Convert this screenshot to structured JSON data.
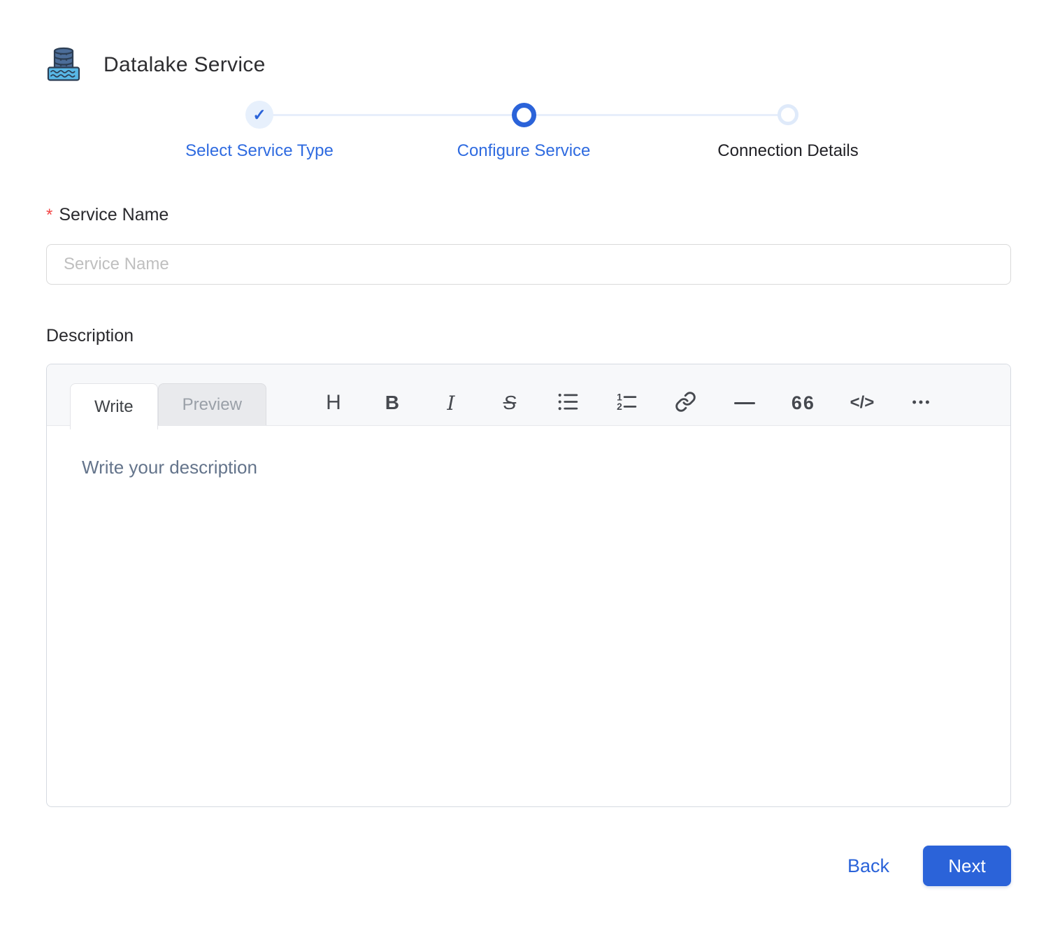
{
  "header": {
    "title": "Datalake Service",
    "icon": "datalake-icon"
  },
  "stepper": {
    "check_glyph": "✓",
    "steps": [
      {
        "label": "Select Service Type",
        "state": "completed"
      },
      {
        "label": "Configure Service",
        "state": "active"
      },
      {
        "label": "Connection Details",
        "state": "pending"
      }
    ]
  },
  "form": {
    "service_name": {
      "label": "Service Name",
      "required_marker": "*",
      "placeholder": "Service Name",
      "value": ""
    },
    "description": {
      "label": "Description",
      "value": ""
    }
  },
  "editor": {
    "tabs": [
      {
        "label": "Write",
        "active": true
      },
      {
        "label": "Preview",
        "active": false
      }
    ],
    "placeholder": "Write your description",
    "toolbar": [
      {
        "name": "heading",
        "glyph": "H"
      },
      {
        "name": "bold",
        "glyph": "B"
      },
      {
        "name": "italic",
        "glyph": "I"
      },
      {
        "name": "strikethrough",
        "glyph": "S"
      },
      {
        "name": "unordered-list",
        "glyph": ""
      },
      {
        "name": "ordered-list",
        "glyph": ""
      },
      {
        "name": "link",
        "glyph": ""
      },
      {
        "name": "horizontal-rule",
        "glyph": ""
      },
      {
        "name": "quote",
        "glyph": "66"
      },
      {
        "name": "code",
        "glyph": "</>"
      },
      {
        "name": "more",
        "glyph": ""
      }
    ]
  },
  "footer": {
    "back_label": "Back",
    "next_label": "Next"
  },
  "colors": {
    "primary": "#2b63d9",
    "step_done_bg": "#e7f0fc",
    "connector": "#e7eefb",
    "pending_ring": "#dfeafa",
    "required": "#f24646",
    "border": "#d9d9d9",
    "toolbar_bg": "#f7f8fa",
    "placeholder_input": "#bfbfbf",
    "placeholder_editor": "#64748b"
  }
}
